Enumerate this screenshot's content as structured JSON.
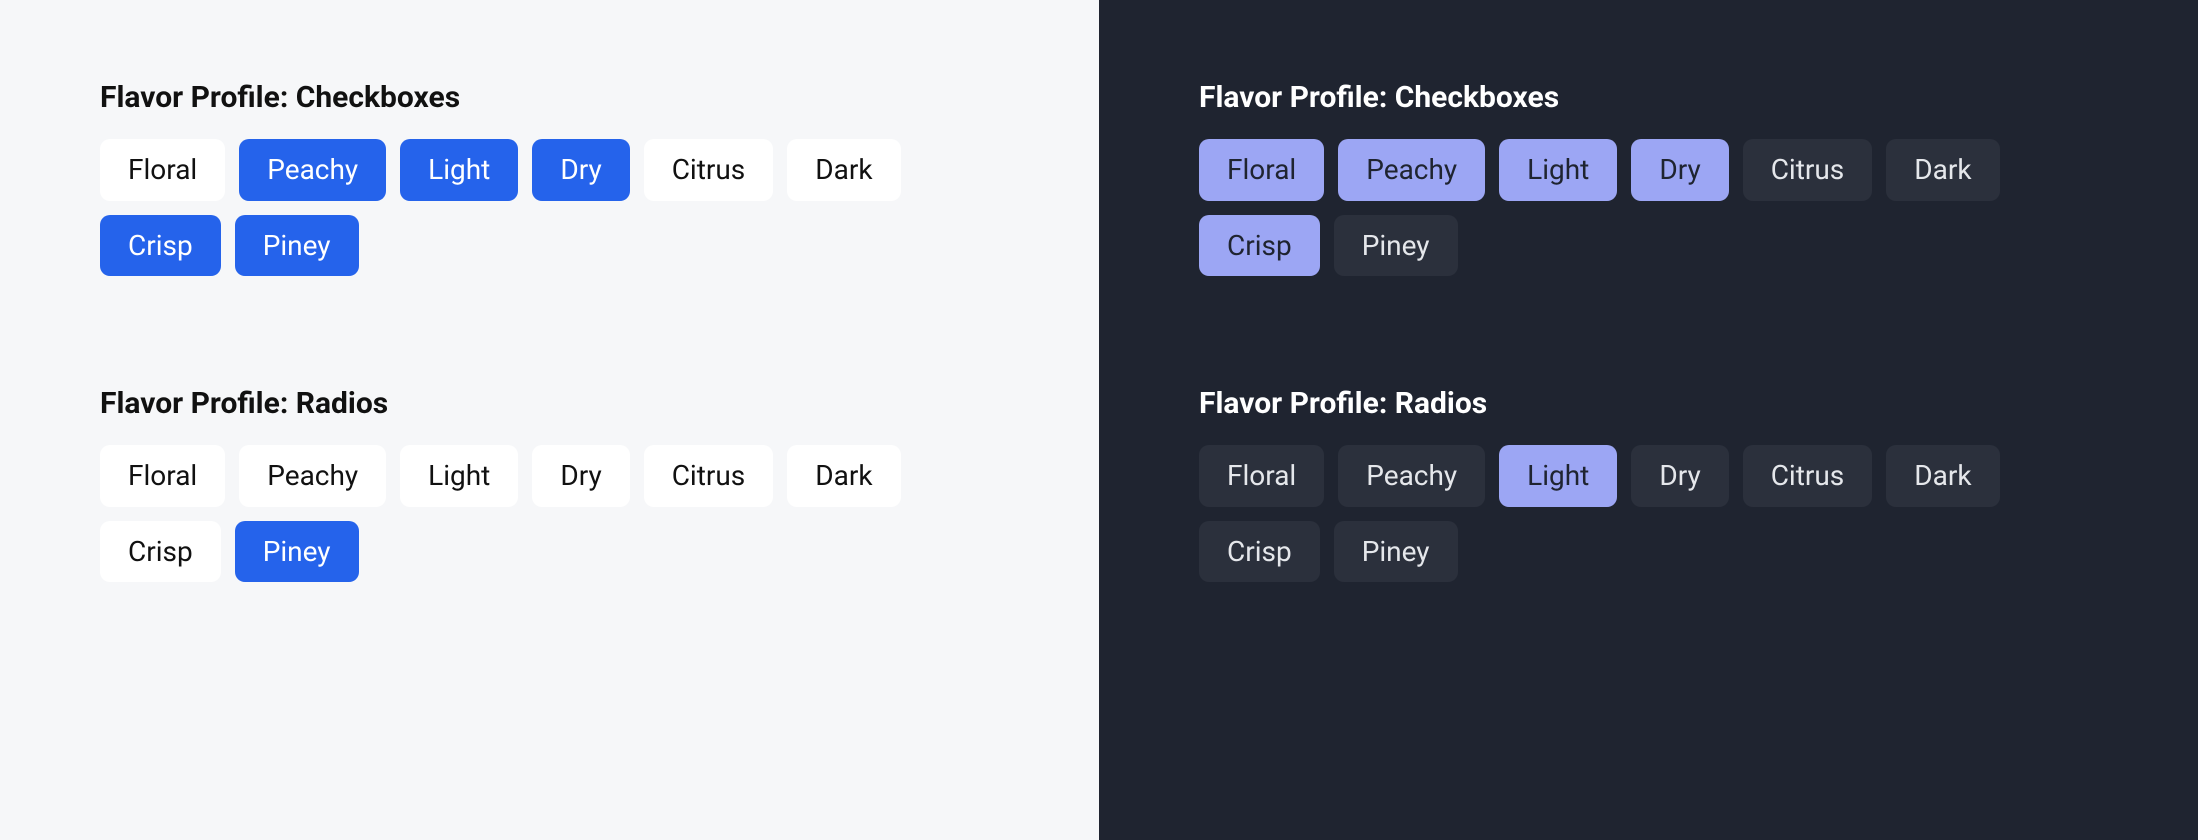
{
  "light": {
    "checkboxes": {
      "heading": "Flavor Profile: Checkboxes",
      "options": [
        {
          "label": "Floral",
          "selected": false
        },
        {
          "label": "Peachy",
          "selected": true
        },
        {
          "label": "Light",
          "selected": true
        },
        {
          "label": "Dry",
          "selected": true
        },
        {
          "label": "Citrus",
          "selected": false
        },
        {
          "label": "Dark",
          "selected": false
        },
        {
          "label": "Crisp",
          "selected": true
        },
        {
          "label": "Piney",
          "selected": true
        }
      ]
    },
    "radios": {
      "heading": "Flavor Profile: Radios",
      "options": [
        {
          "label": "Floral",
          "selected": false
        },
        {
          "label": "Peachy",
          "selected": false
        },
        {
          "label": "Light",
          "selected": false
        },
        {
          "label": "Dry",
          "selected": false
        },
        {
          "label": "Citrus",
          "selected": false
        },
        {
          "label": "Dark",
          "selected": false
        },
        {
          "label": "Crisp",
          "selected": false
        },
        {
          "label": "Piney",
          "selected": true
        }
      ]
    }
  },
  "dark": {
    "checkboxes": {
      "heading": "Flavor Profile: Checkboxes",
      "options": [
        {
          "label": "Floral",
          "selected": true
        },
        {
          "label": "Peachy",
          "selected": true
        },
        {
          "label": "Light",
          "selected": true
        },
        {
          "label": "Dry",
          "selected": true
        },
        {
          "label": "Citrus",
          "selected": false
        },
        {
          "label": "Dark",
          "selected": false
        },
        {
          "label": "Crisp",
          "selected": true
        },
        {
          "label": "Piney",
          "selected": false
        }
      ]
    },
    "radios": {
      "heading": "Flavor Profile: Radios",
      "options": [
        {
          "label": "Floral",
          "selected": false
        },
        {
          "label": "Peachy",
          "selected": false
        },
        {
          "label": "Light",
          "selected": true
        },
        {
          "label": "Dry",
          "selected": false
        },
        {
          "label": "Citrus",
          "selected": false
        },
        {
          "label": "Dark",
          "selected": false
        },
        {
          "label": "Crisp",
          "selected": false
        },
        {
          "label": "Piney",
          "selected": false
        }
      ]
    }
  },
  "colors": {
    "light_bg": "#f6f7f9",
    "light_chip_bg": "#ffffff",
    "light_chip_selected": "#2563eb",
    "dark_bg": "#1f2430",
    "dark_chip_bg": "#2b303c",
    "dark_chip_selected": "#9ca6f4"
  }
}
